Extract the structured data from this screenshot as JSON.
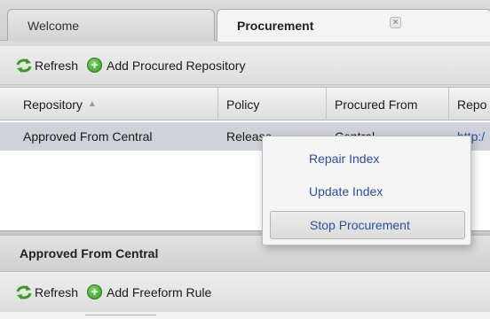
{
  "tabs": [
    {
      "label": "Welcome"
    },
    {
      "label": "Procurement",
      "close_icon": "close-icon"
    }
  ],
  "toolbar": {
    "refresh_label": "Refresh",
    "add_label": "Add Procured Repository"
  },
  "grid": {
    "columns": [
      "Repository",
      "Policy",
      "Procured From",
      "Repo"
    ],
    "sort_column": "Repository",
    "sort_direction": "ascending",
    "rows": [
      {
        "repository": "Approved From Central",
        "policy": "Release",
        "procured_from": "Central",
        "repo": "http:/"
      }
    ],
    "selected_row_color": "#cfd3d9"
  },
  "context_menu": {
    "items": [
      "Repair Index",
      "Update Index",
      "Stop Procurement"
    ],
    "hovered_item": "Stop Procurement",
    "text_color": "#2c4f9e"
  },
  "detail": {
    "title": "Approved From Central",
    "toolbar": {
      "refresh_label": "Refresh",
      "add_label": "Add Freeform Rule"
    }
  },
  "icons": {
    "refresh": "refresh-icon",
    "add": "add-icon",
    "sort": "sort-ascending-icon"
  }
}
